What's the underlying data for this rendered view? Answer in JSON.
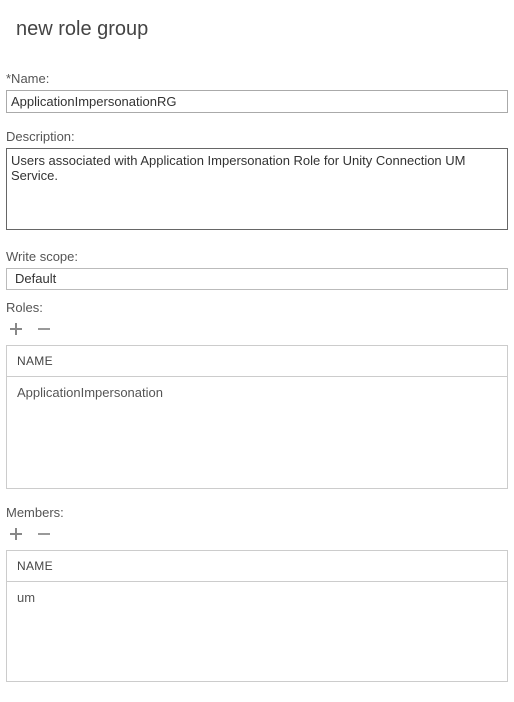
{
  "header": {
    "title": "new role group"
  },
  "name_field": {
    "label": "*Name:",
    "value": "ApplicationImpersonationRG"
  },
  "description_field": {
    "label": "Description:",
    "value": "Users associated with Application Impersonation Role for Unity Connection UM Service."
  },
  "writescope_field": {
    "label": "Write scope:",
    "value": "Default"
  },
  "roles": {
    "label": "Roles:",
    "column_header": "NAME",
    "items": [
      "ApplicationImpersonation"
    ]
  },
  "members": {
    "label": "Members:",
    "column_header": "NAME",
    "items": [
      "um"
    ]
  }
}
